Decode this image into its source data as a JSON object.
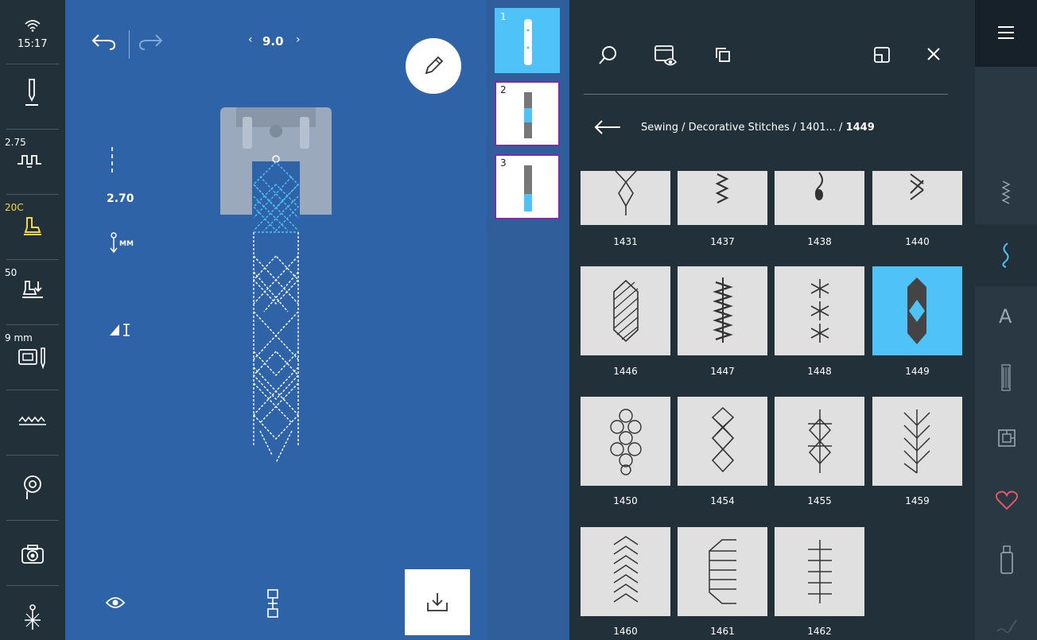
{
  "status": {
    "time": "15:17",
    "stitch_length": "2.75",
    "presser_foot": "20C",
    "foot_pressure": "50",
    "needle_plate": "9 mm"
  },
  "canvas": {
    "pattern_width": "9.0",
    "stitch_length_value": "2.70",
    "length_unit": "MM"
  },
  "thumbnails": [
    {
      "num": "1",
      "selected": true
    },
    {
      "num": "2",
      "selected": false
    },
    {
      "num": "3",
      "selected": false
    }
  ],
  "breadcrumb": {
    "path": "Sewing / Decorative Stitches / 1401... / ",
    "current": "1449"
  },
  "stitches": [
    {
      "id": "1431"
    },
    {
      "id": "1437"
    },
    {
      "id": "1438"
    },
    {
      "id": "1440"
    },
    {
      "id": "1446"
    },
    {
      "id": "1447"
    },
    {
      "id": "1448"
    },
    {
      "id": "1449",
      "selected": true
    },
    {
      "id": "1450"
    },
    {
      "id": "1454"
    },
    {
      "id": "1455"
    },
    {
      "id": "1459"
    },
    {
      "id": "1460"
    },
    {
      "id": "1461"
    },
    {
      "id": "1462"
    }
  ],
  "colors": {
    "canvas_blue": "#2e63a8",
    "accent_cyan": "#4fc3f7",
    "dark_panel": "#22303a",
    "favorite_red": "#e05a63"
  }
}
